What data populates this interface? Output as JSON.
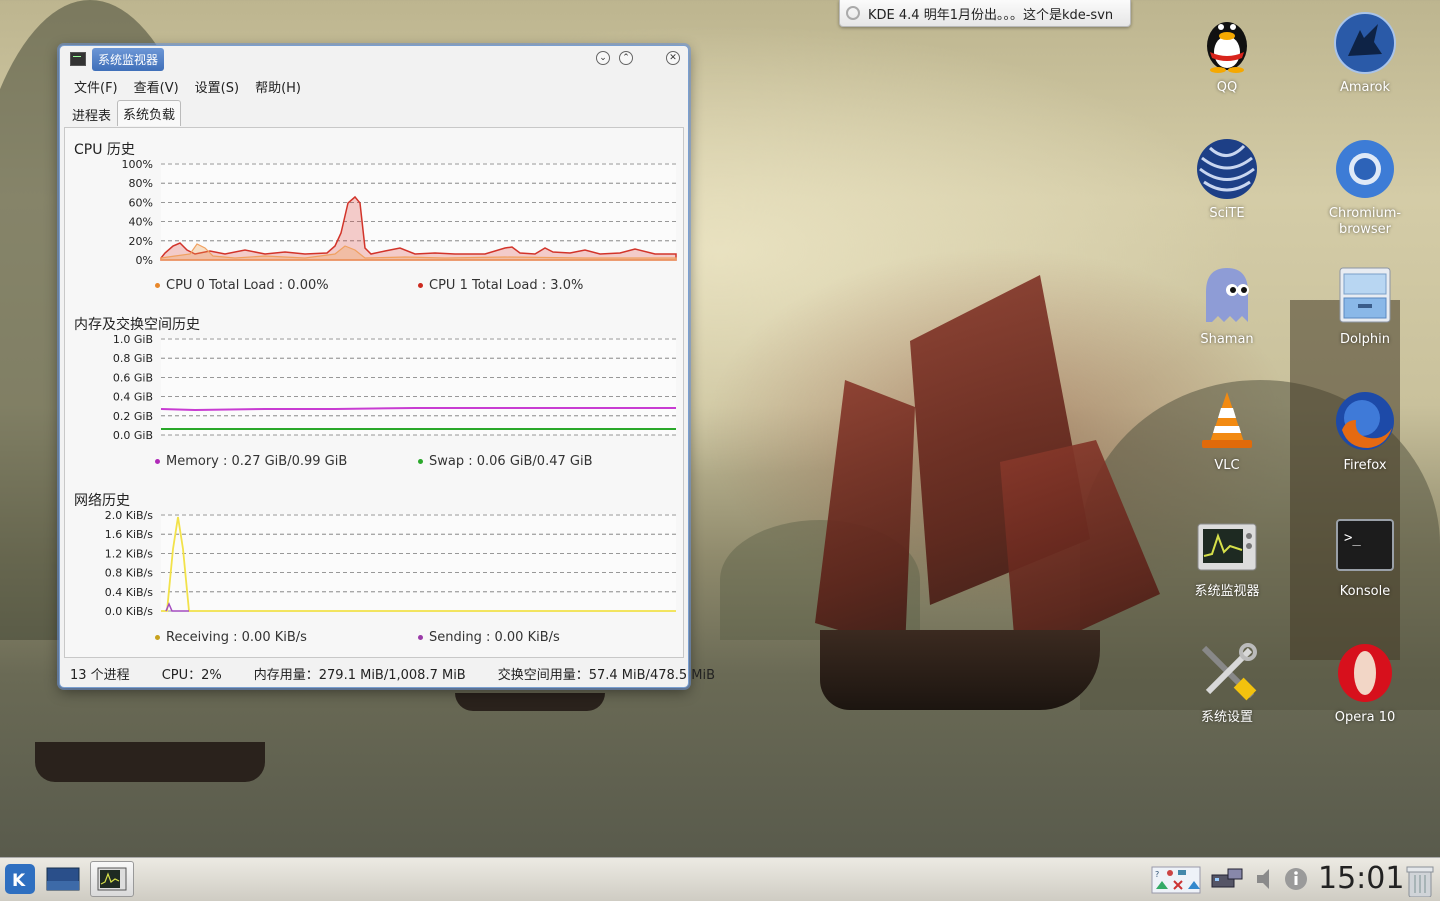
{
  "notification": {
    "text": "KDE 4.4 明年1月份出。。。这个是kde-svn"
  },
  "window": {
    "title": "系统监视器",
    "menu": [
      "文件(F)",
      "查看(V)",
      "设置(S)",
      "帮助(H)"
    ],
    "tabs": [
      "进程表",
      "系统负载"
    ],
    "cpu": {
      "title": "CPU 历史",
      "ticks": [
        "100%",
        "80%",
        "60%",
        "40%",
        "20%",
        "0%"
      ],
      "legend": [
        {
          "label": "CPU 0 Total Load : 0.00%",
          "color": "#e8872a"
        },
        {
          "label": "CPU 1 Total Load : 3.0%",
          "color": "#cc2a1f"
        }
      ]
    },
    "memory": {
      "title": "内存及交换空间历史",
      "ticks": [
        "1.0 GiB",
        "0.8 GiB",
        "0.6 GiB",
        "0.4 GiB",
        "0.2 GiB",
        "0.0 GiB"
      ],
      "legend": [
        {
          "label": "Memory : 0.27 GiB/0.99 GiB",
          "color": "#b02ab8"
        },
        {
          "label": "Swap : 0.06 GiB/0.47 GiB",
          "color": "#2aa82a"
        }
      ]
    },
    "network": {
      "title": "网络历史",
      "ticks": [
        "2.0 KiB/s",
        "1.6 KiB/s",
        "1.2 KiB/s",
        "0.8 KiB/s",
        "0.4 KiB/s",
        "0.0 KiB/s"
      ],
      "legend": [
        {
          "label": "Receiving : 0.00 KiB/s",
          "color": "#c8a21e"
        },
        {
          "label": "Sending : 0.00 KiB/s",
          "color": "#9a3aa8"
        }
      ]
    },
    "status": {
      "processes": "13 个进程",
      "cpu": "CPU：2%",
      "memory": "内存用量：279.1 MiB/1,008.7 MiB",
      "swap": "交换空间用量：57.4 MiB/478.5 MiB"
    }
  },
  "desktop_icons": [
    {
      "label": "QQ",
      "icon": "qq-penguin-icon"
    },
    {
      "label": "Amarok",
      "icon": "amarok-wolf-icon"
    },
    {
      "label": "SciTE",
      "icon": "scite-sphere-icon"
    },
    {
      "label": "Chromium-browser",
      "icon": "chromium-icon"
    },
    {
      "label": "Shaman",
      "icon": "shaman-ghost-icon"
    },
    {
      "label": "Dolphin",
      "icon": "dolphin-drawer-icon"
    },
    {
      "label": "VLC",
      "icon": "vlc-cone-icon"
    },
    {
      "label": "Firefox",
      "icon": "firefox-icon"
    },
    {
      "label": "系统监视器",
      "icon": "system-monitor-icon"
    },
    {
      "label": "Konsole",
      "icon": "konsole-terminal-icon"
    },
    {
      "label": "系统设置",
      "icon": "system-settings-icon"
    },
    {
      "label": "Opera 10",
      "icon": "opera-icon"
    }
  ],
  "taskbar": {
    "clock": "15:01"
  }
}
